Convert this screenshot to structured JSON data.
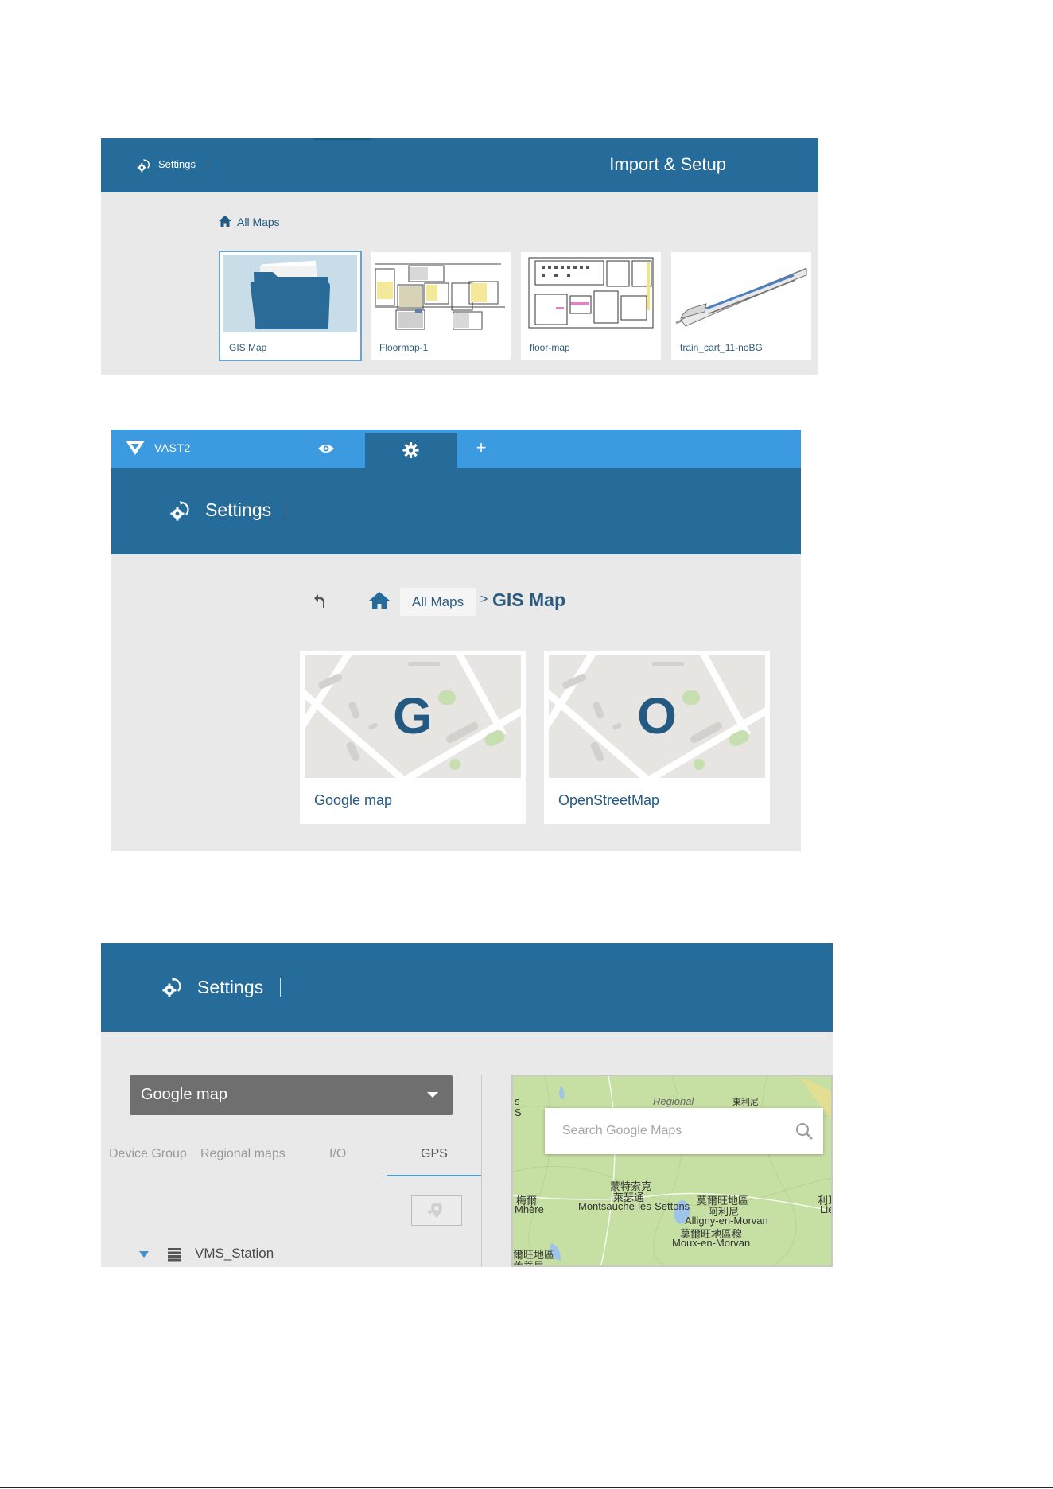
{
  "panel1": {
    "settings_label": "Settings",
    "title": "Import & Setup",
    "breadcrumb": "All Maps",
    "cards": [
      {
        "label": "GIS Map"
      },
      {
        "label": "Floormap-1"
      },
      {
        "label": "floor-map"
      },
      {
        "label": "train_cart_11-noBG"
      }
    ]
  },
  "panel2": {
    "brand": "VAST2",
    "tabs": {
      "plus": "+"
    },
    "settings_label": "Settings",
    "breadcrumb": {
      "all_maps": "All Maps",
      "separator": ">",
      "current": "GIS Map"
    },
    "cards": [
      {
        "label": "Google map",
        "letter": "G"
      },
      {
        "label": "OpenStreetMap",
        "letter": "O"
      }
    ]
  },
  "panel3": {
    "settings_label": "Settings",
    "dropdown_value": "Google map",
    "tabs": [
      "Device Group",
      "Regional maps",
      "I/O",
      "GPS"
    ],
    "active_tab": "GPS",
    "tree_node": "VMS_Station",
    "map": {
      "search_placeholder": "Search Google Maps",
      "labels": [
        {
          "text": "Regional"
        },
        {
          "text": "東利尼"
        },
        {
          "text": "蒙特索克"
        },
        {
          "text": "萊瑟通"
        },
        {
          "text": "梅爾"
        },
        {
          "text": "Mhère"
        },
        {
          "text": "Montsauche-les-Settons"
        },
        {
          "text": "莫爾旺地區"
        },
        {
          "text": "阿利尼"
        },
        {
          "text": "Alligny-en-Morvan"
        },
        {
          "text": "莫爾旺地區穆"
        },
        {
          "text": "Moux-en-Morvan"
        },
        {
          "text": "爾旺地區"
        },
        {
          "text": "萊蒂尼"
        },
        {
          "text": "利耳"
        },
        {
          "text": "Lie"
        },
        {
          "text": "s"
        },
        {
          "text": "S"
        }
      ]
    }
  },
  "colors": {
    "header_blue": "#266c9a",
    "topbar_blue": "#3c9ae0",
    "panel_bg": "#e9e9e9",
    "text_blue": "#245a82"
  }
}
